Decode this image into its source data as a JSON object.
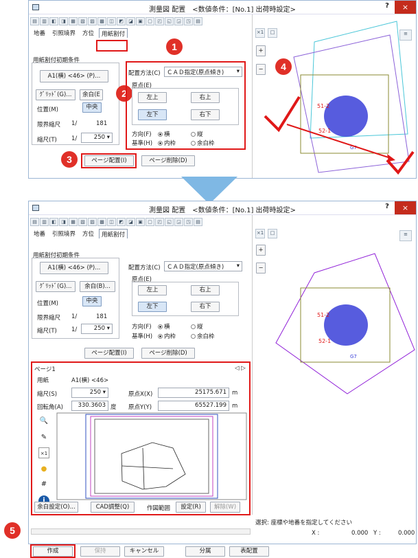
{
  "window": {
    "title": "測量図 配置　<数値条件：[No.1] 出荷時設定>",
    "help": "?",
    "close": "×"
  },
  "tabs": [
    "地番",
    "引照境界",
    "方位",
    "用紙割付"
  ],
  "tabs_first": [
    "地番",
    "引照境界",
    "方位"
  ],
  "active_tab": "用紙割付",
  "group_title": "用紙割付初期条件",
  "paper_btn": "A1(横) <46> (P)...",
  "grid_btn": "ｸﾞﾘｯﾄﾞ(G)...",
  "margin_btn": "余白(B)...",
  "margin_btn_cut": "余白(E",
  "position_label": "位置(M)",
  "position_value": "中央",
  "limit_label": "限界縮尺",
  "limit_prefix": "1/",
  "limit_value": "181",
  "scale_label": "縮尺(T)",
  "scale_prefix": "1/",
  "scale_value": "250",
  "placement_label": "配置方法(C)",
  "placement_value": "ＣＡＤ指定(原点傾き)",
  "origin_label": "原点(E)",
  "origin_buttons": [
    "左上",
    "右上",
    "左下",
    "右下"
  ],
  "direction_label": "方向(F)",
  "direction_opts": [
    "横",
    "縦"
  ],
  "base_label": "基準(H)",
  "base_opts": [
    "内枠",
    "余白枠"
  ],
  "page_place_btn": "ページ配置(I)",
  "page_delete_btn": "ページ削除(D)",
  "zoom_btns": [
    "+",
    "−"
  ],
  "callouts": [
    "1",
    "2",
    "3",
    "4",
    "5"
  ],
  "page_section": {
    "tab": "ページ1",
    "paper_label": "用紙",
    "paper_value": "A1(横) <46>",
    "scale_label": "縮尺(S)",
    "scale_value": "250",
    "rotation_label": "回転角(A)",
    "rotation_value": "330.3603",
    "rotation_unit": "度",
    "ox_label": "原点X(X)",
    "ox_value": "25175.671",
    "ox_unit": "m",
    "oy_label": "原点Y(Y)",
    "oy_value": "65527.199",
    "oy_unit": "m",
    "buttons": [
      "余白設定(O)...",
      "CAD調整(Q)",
      "作図範囲",
      "設定(R)",
      "解除(W)"
    ]
  },
  "status": {
    "text": "選択: 座標や地番を指定してください",
    "x_label": "X :",
    "x_value": "0.000",
    "y_label": "Y :",
    "y_value": "0.000"
  },
  "bottom_buttons": [
    "作成",
    "保持",
    "キャンセル",
    "分属",
    "表配置"
  ],
  "map_labels": [
    "51-2",
    "52-1",
    "G7"
  ],
  "colors": {
    "accent": "#e01818",
    "tri": "#7fb8e4",
    "close": "#c42b1c"
  }
}
